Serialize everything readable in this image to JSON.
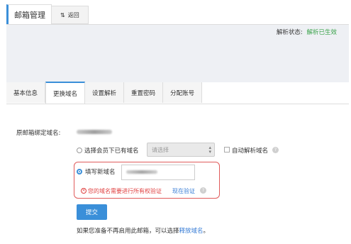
{
  "top_tabs": {
    "active_label": "邮箱管理",
    "back_label": "返回",
    "back_icon": "swap-arrows-icon"
  },
  "status": {
    "label": "解析状态:",
    "value": "解析已生效",
    "value_color": "#3aa34a"
  },
  "tabs": [
    {
      "label": "基本信息",
      "active": false
    },
    {
      "label": "更换域名",
      "active": true
    },
    {
      "label": "设置解析",
      "active": false
    },
    {
      "label": "重置密码",
      "active": false
    },
    {
      "label": "分配账号",
      "active": false
    }
  ],
  "form": {
    "original_domain_label": "原邮箱绑定域名:",
    "option_existing_label": "选择会员下已有域名",
    "select_placeholder": "请选择",
    "auto_resolve_label": "自动解析域名",
    "option_new_label": "填写新域名",
    "error_text": "您的域名需要进行所有权验证",
    "verify_link": "现在验证",
    "submit_label": "提交",
    "footer_text": "如果您准备不再启用此邮箱，可以选择",
    "footer_link": "释放域名",
    "footer_end": "。"
  },
  "colors": {
    "accent": "#3a8fd9",
    "error": "#e04040",
    "link": "#3a7ed6"
  }
}
